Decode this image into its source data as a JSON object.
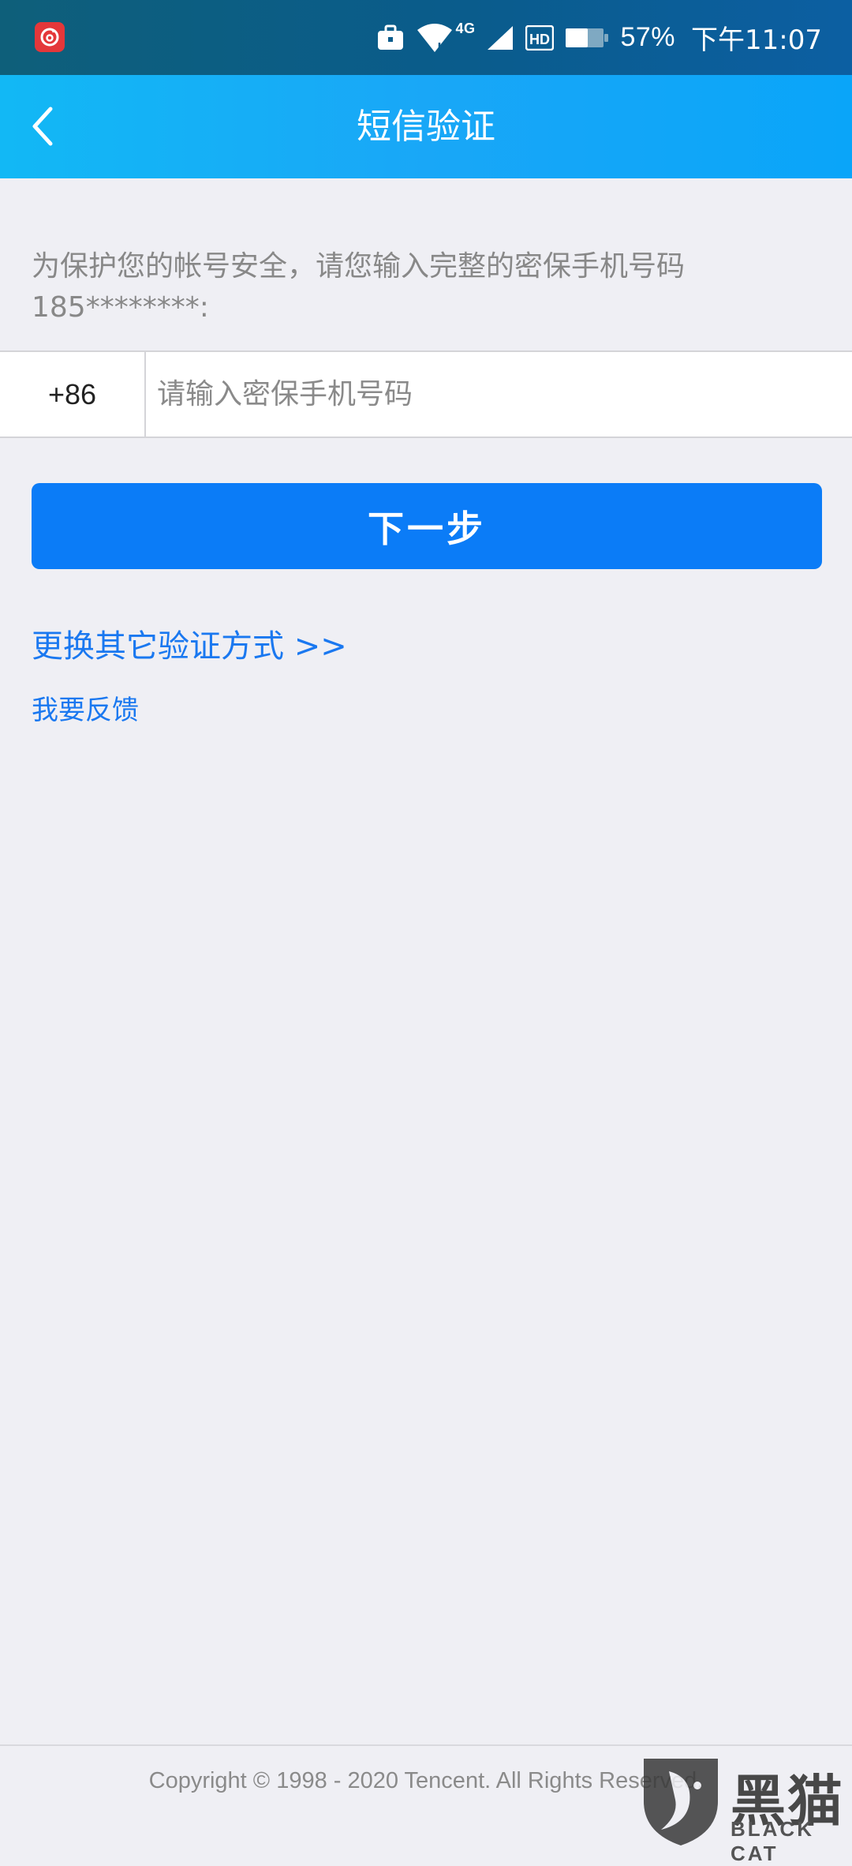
{
  "status_bar": {
    "battery_percent": "57%",
    "time": "下午11:07",
    "network_type": "4G",
    "hd_badge": "HD",
    "app_icon": "netease-music-icon",
    "icons": [
      "briefcase-icon",
      "wifi-icon",
      "cell-signal-icon",
      "hd-icon",
      "battery-icon"
    ]
  },
  "header": {
    "title": "短信验证",
    "back_icon": "chevron-left-icon",
    "background_start": "#12b8f5",
    "background_end": "#0aa5f9"
  },
  "instruction": {
    "text": "为保护您的帐号安全，请您输入完整的密保手机号码185********:"
  },
  "phone_form": {
    "country_code": "+86",
    "phone_placeholder": "请输入密保手机号码",
    "phone_value": ""
  },
  "next_button": {
    "label": "下一步",
    "color": "#0b7cf7"
  },
  "links": {
    "alt_method": "更换其它验证方式 >>",
    "feedback": "我要反馈",
    "color": "#1a78f0"
  },
  "footer": {
    "copyright": "Copyright © 1998 - 2020 Tencent. All Rights Reserved."
  },
  "watermark": {
    "text_cn": "黑猫",
    "text_en": "BLACK CAT"
  }
}
